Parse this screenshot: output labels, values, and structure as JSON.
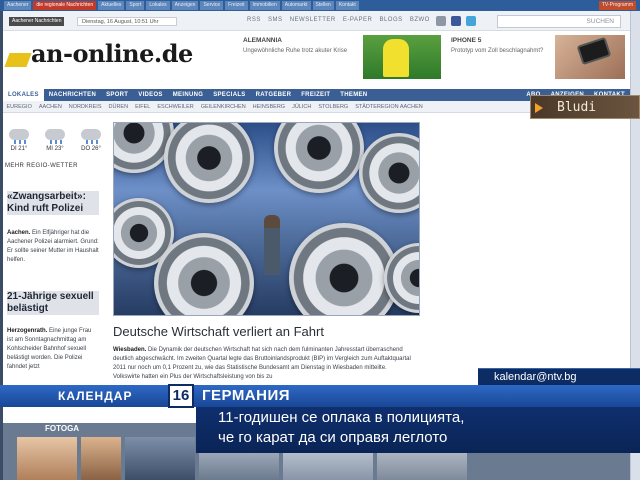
{
  "tabs": [
    "Aachener",
    "die regionale Nachrichten",
    "Aktuelles",
    "Sport",
    "Lokales",
    "Anzeigen",
    "Service",
    "Freizeit",
    "Immobilien",
    "Automarkt",
    "Stellen",
    "Kontakt",
    "TV-Programm"
  ],
  "meta": {
    "tag": "Aachener Nachrichten",
    "date": "Dienstag, 16 August, 10:51 Uhr",
    "links": [
      "RSS",
      "SMS",
      "NEWSLETTER",
      "E-PAPER",
      "BLOGS",
      "BZWO"
    ],
    "search_label": "SUCHEN"
  },
  "logo": "an-online.de",
  "promos": {
    "alem_title": "ALEMANNIA",
    "alem_sub": "Ungewöhnliche Ruhe trotz akuter Krise",
    "iphone_title": "IPHONE 5",
    "iphone_sub": "Prototyp vom Zoll beschlagnahmt?"
  },
  "mainnav": {
    "left": [
      "LOKALES",
      "NACHRICHTEN",
      "SPORT",
      "VIDEOS",
      "MEINUNG",
      "SPECIALS",
      "RATGEBER",
      "FREIZEIT",
      "THEMEN"
    ],
    "right": [
      "ABO",
      "ANZEIGEN",
      "KONTAKT"
    ]
  },
  "regions": [
    "EUREGIO",
    "AACHEN",
    "NORDKREIS",
    "DÜREN",
    "EIFEL",
    "ESCHWEILER",
    "GEILENKIRCHEN",
    "HEINSBERG",
    "JÜLICH",
    "STOLBERG",
    "STÄDTEREGION AACHEN"
  ],
  "weather": {
    "days": [
      "DI 21°",
      "MI 23°",
      "DO 26°"
    ],
    "more": "MEHR REGIO-WETTER"
  },
  "stories": {
    "s1_head": "«Zwangsarbeit»: Kind ruft Polizei",
    "s1_place": "Aachen.",
    "s1_text": " Ein Elfjähriger hat die Aachener Polizei alarmiert. Grund: Er sollte seiner Mutter im Haushalt helfen.",
    "s2_head": "21-Jährige sexuell belästigt",
    "s2_place": "Herzogenrath.",
    "s2_text": " Eine junge Frau ist am Sonntagnachmittag am Kohlscheider Bahnhof sexuell belästigt worden. Die Polizei fahndet jetzt"
  },
  "article": {
    "headline": "Deutsche Wirtschaft verliert an Fahrt",
    "place": "Wiesbaden.",
    "text": " Die Dynamik der deutschen Wirtschaft hat sich nach dem fulminanten Jahresstart überraschend deutlich abgeschwächt. Im zweiten Quartal legte das Bruttoinlandsprodukt (BIP) im Vergleich zum Auftaktquartal 2011 nur noch um 0,1 Prozent zu, wie das Statistische Bundesamt am Dienstag in Wiesbaden mitteilte. Volkswirte hatten ein Plus der Wirtschaftsleistung von bis zu"
  },
  "fotostrip": "FOTOGA",
  "overlay": {
    "bludi": "Bludi",
    "email": "kalendar@ntv.bg",
    "kal_label": "КАЛЕНДАР",
    "kal_date": "16",
    "topic": "ГЕРМАНИЯ",
    "line1": "11-годишен се оплака в полицията,",
    "line2": "че го карат да си оправя леглото"
  }
}
